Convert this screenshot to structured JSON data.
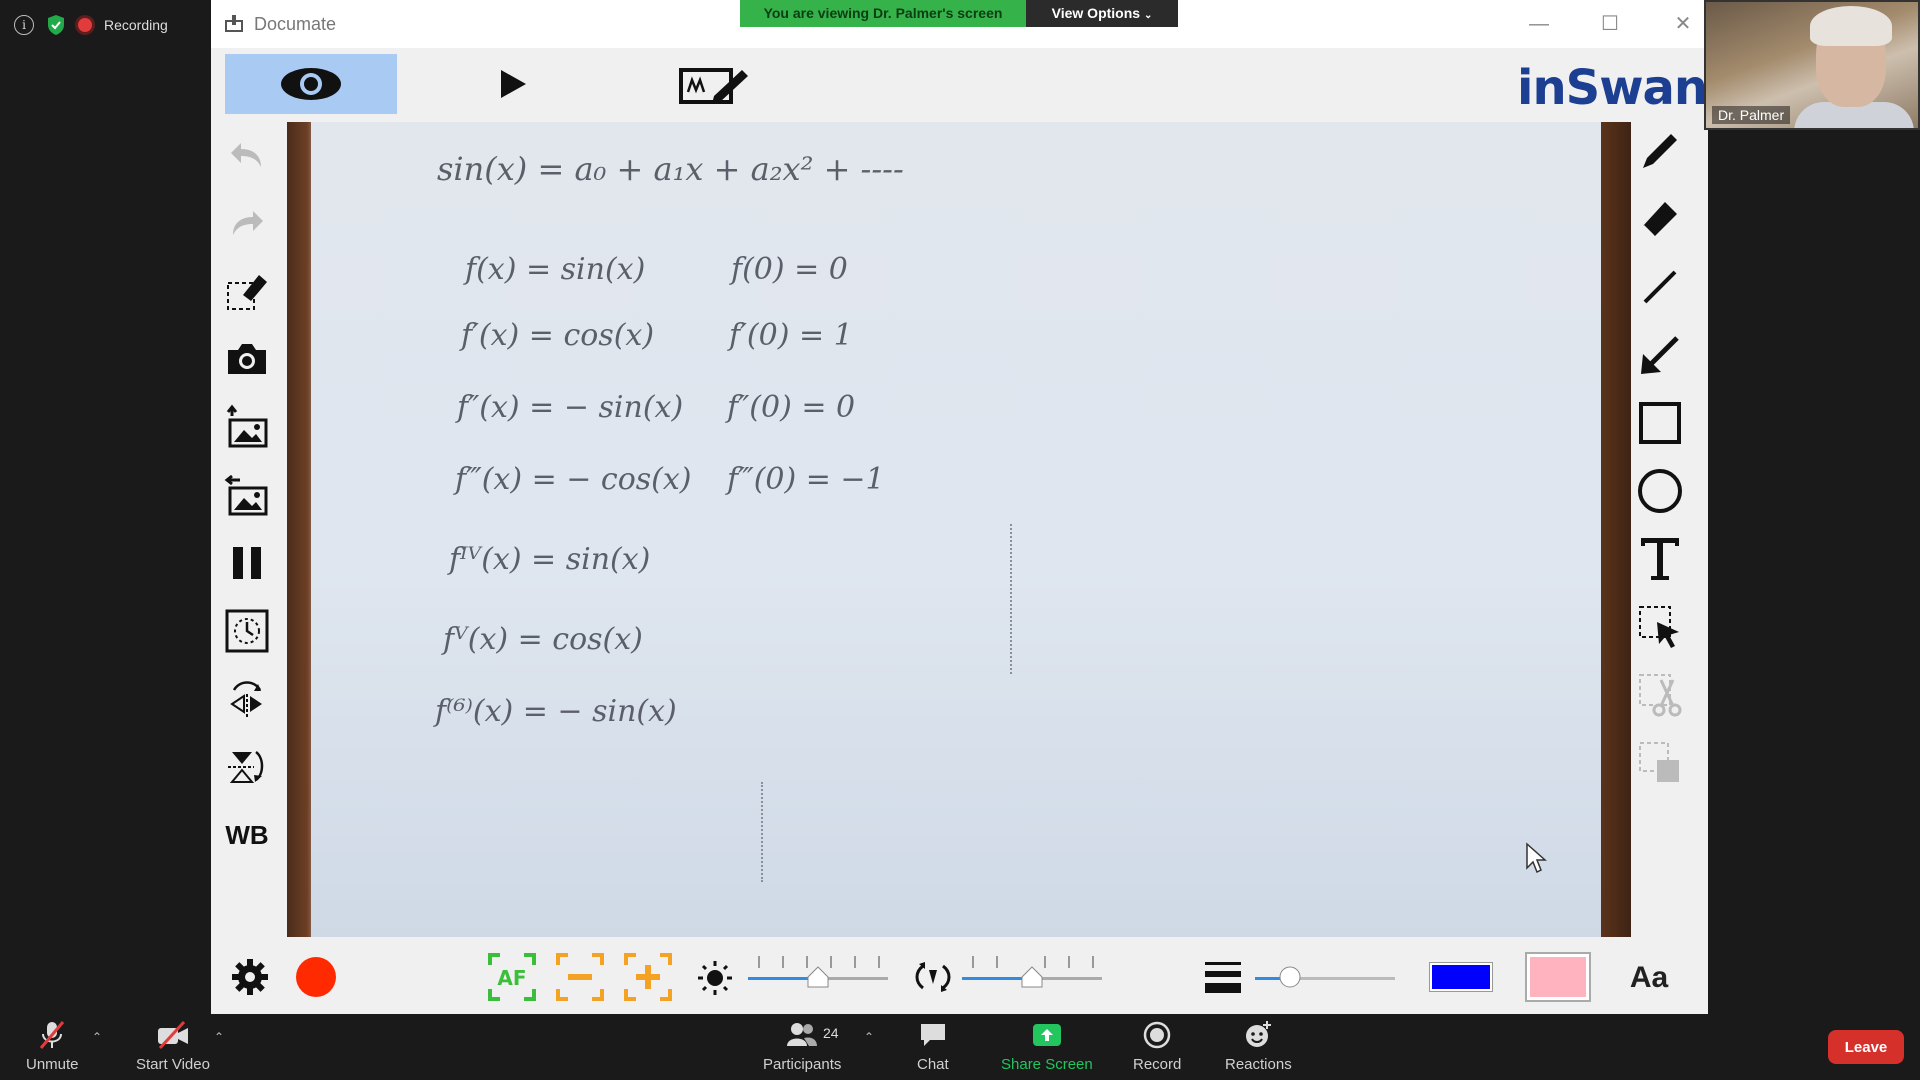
{
  "zoom": {
    "recording_label": "Recording",
    "banner_text": "You are viewing Dr. Palmer's screen",
    "view_options_label": "View Options",
    "participant_name": "Dr. Palmer",
    "bottom": {
      "unmute": "Unmute",
      "start_video": "Start Video",
      "participants": "Participants",
      "participants_count": "24",
      "chat": "Chat",
      "share_screen": "Share Screen",
      "record": "Record",
      "reactions": "Reactions",
      "leave": "Leave"
    }
  },
  "app": {
    "title": "Documate",
    "logo": "inSwan",
    "left_wb_label": "WB",
    "font_button_label": "Aa",
    "pen_color": "#0000ff",
    "fill_color": "#ffb3be",
    "record_color": "#ff2a00"
  },
  "board": {
    "main_equation": "sin(x) = a₀ + a₁x + a₂x² + ----",
    "left_column": [
      "f(x) = sin(x)",
      "f′(x) = cos(x)",
      "f″(x) = − sin(x)",
      "f‴(x) = − cos(x)",
      "fᴵⱽ(x) = sin(x)",
      "fⱽ(x) = cos(x)",
      "f⁽⁶⁾(x) = − sin(x)"
    ],
    "right_column": [
      "f(0) = 0",
      "f′(0) = 1",
      "f″(0) = 0",
      "f‴(0) = −1"
    ]
  },
  "sliders": {
    "brightness_level": 0.5,
    "rotation_level": 0.5,
    "line_width_level": 0.25
  }
}
